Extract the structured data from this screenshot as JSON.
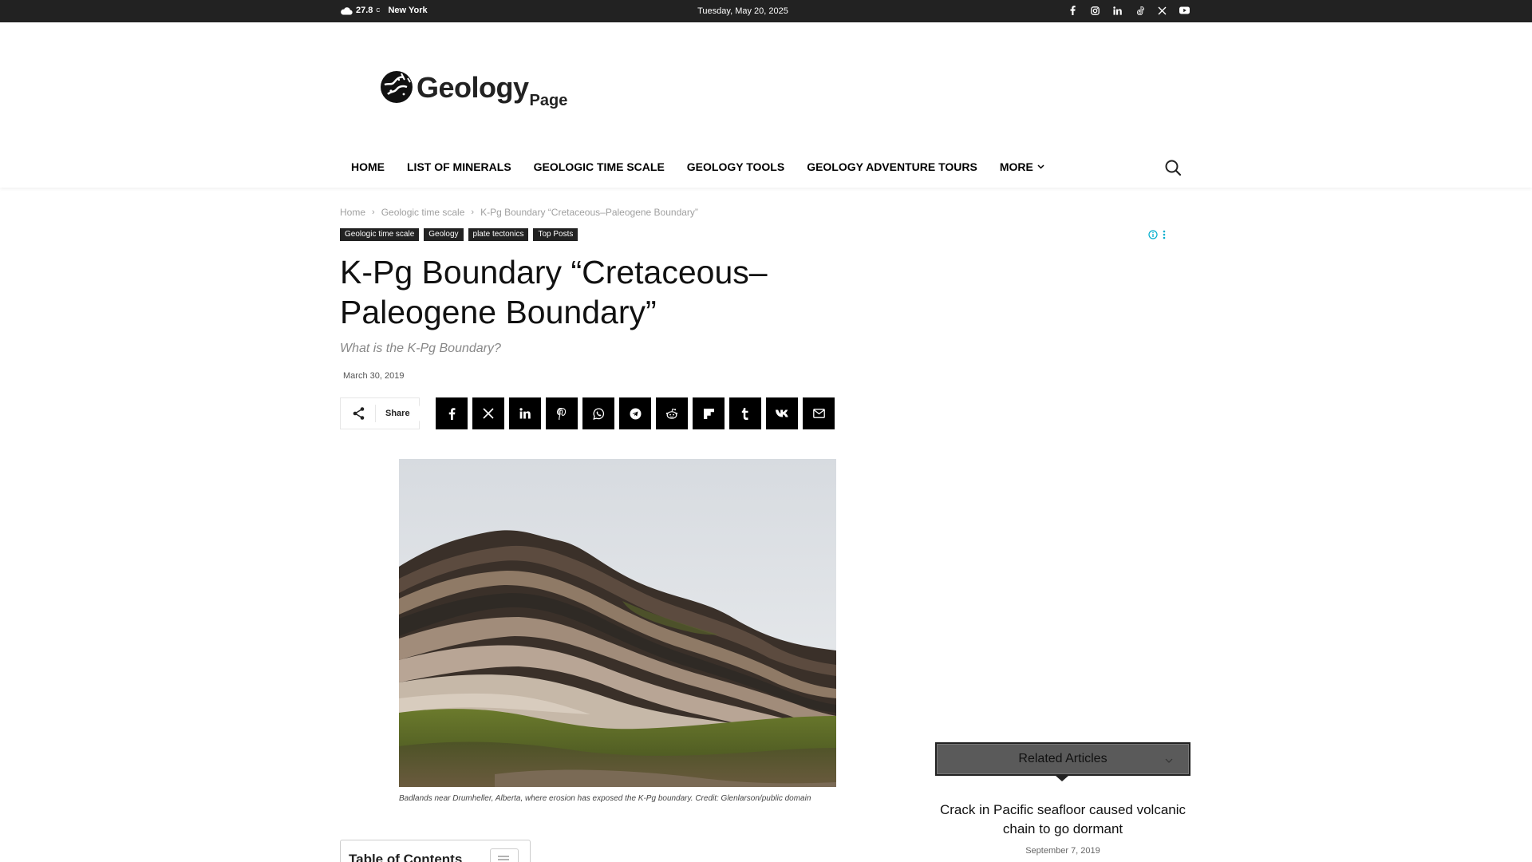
{
  "topbar": {
    "temperature": "27.8",
    "temp_unit": "C",
    "city": "New York",
    "date": "Tuesday, May 20, 2025",
    "social_icons": [
      "facebook-icon",
      "instagram-icon",
      "linkedin-icon",
      "tiktok-icon",
      "x-icon",
      "youtube-icon"
    ]
  },
  "logo": {
    "main": "Geology",
    "sub": "Page"
  },
  "nav": {
    "items": [
      "HOME",
      "LIST OF MINERALS",
      "GEOLOGIC TIME SCALE",
      "GEOLOGY TOOLS",
      "GEOLOGY ADVENTURE TOURS",
      "MORE"
    ]
  },
  "breadcrumb": {
    "home": "Home",
    "category": "Geologic time scale",
    "current": "K-Pg Boundary “Cretaceous–Paleogene Boundary”"
  },
  "tags": [
    "Geologic time scale",
    "Geology",
    "plate tectonics",
    "Top Posts"
  ],
  "article": {
    "title": "K-Pg Boundary “Cretaceous–Paleogene Boundary”",
    "subtitle": "What is the K-Pg Boundary?",
    "date": "March 30, 2019",
    "share_label": "Share",
    "share_buttons": [
      "facebook-icon",
      "x-icon",
      "linkedin-icon",
      "pinterest-icon",
      "whatsapp-icon",
      "telegram-icon",
      "reddit-icon",
      "flipboard-icon",
      "tumblr-icon",
      "vk-icon",
      "email-icon"
    ],
    "image_caption": "Badlands near Drumheller, Alberta, where erosion has exposed the K-Pg boundary. Credit: Glenlarson/public domain",
    "toc_title": "Table of Contents"
  },
  "sidebar": {
    "related_title": "Related Articles",
    "related_post_title": "Crack in Pacific seafloor caused volcanic chain to go dormant",
    "related_post_date": "September 7, 2019"
  },
  "colors": {
    "topbar_bg": "#222222",
    "tag_bg": "#222222",
    "share_btn_bg": "#000000",
    "related_header_bg": "#5a5a5a",
    "ad_icon": "#00aecd"
  }
}
